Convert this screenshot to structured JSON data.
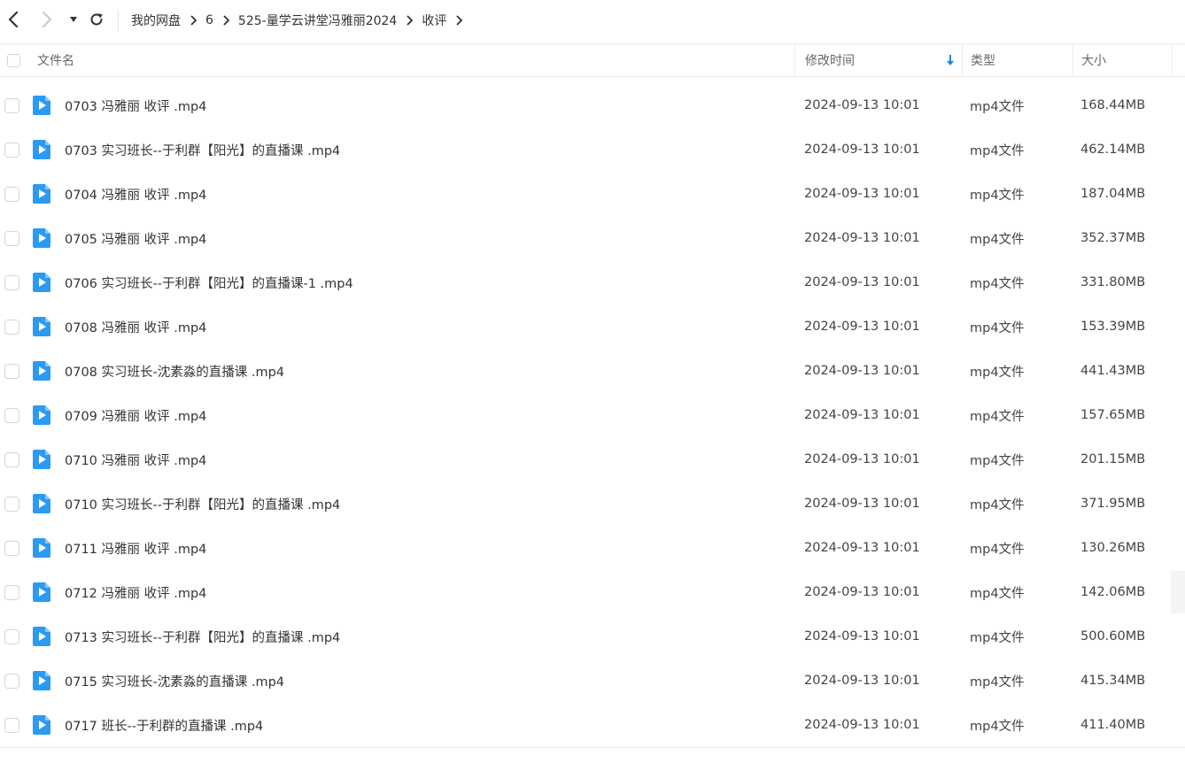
{
  "breadcrumb": [
    "我的网盘",
    "6",
    "525-量学云讲堂冯雅丽2024",
    "收评"
  ],
  "columns": {
    "name": "文件名",
    "time": "修改时间",
    "type": "类型",
    "size": "大小"
  },
  "sort_icon": "arrow-down-icon",
  "accent_color": "#1e88e5",
  "files": [
    {
      "name": "0703 冯雅丽 收评 .mp4",
      "time": "2024-09-13 10:01",
      "type": "mp4文件",
      "size": "168.44MB"
    },
    {
      "name": "0703 实习班长--于利群【阳光】的直播课 .mp4",
      "time": "2024-09-13 10:01",
      "type": "mp4文件",
      "size": "462.14MB"
    },
    {
      "name": "0704 冯雅丽 收评 .mp4",
      "time": "2024-09-13 10:01",
      "type": "mp4文件",
      "size": "187.04MB"
    },
    {
      "name": "0705 冯雅丽 收评 .mp4",
      "time": "2024-09-13 10:01",
      "type": "mp4文件",
      "size": "352.37MB"
    },
    {
      "name": "0706 实习班长--于利群【阳光】的直播课-1 .mp4",
      "time": "2024-09-13 10:01",
      "type": "mp4文件",
      "size": "331.80MB"
    },
    {
      "name": "0708 冯雅丽 收评 .mp4",
      "time": "2024-09-13 10:01",
      "type": "mp4文件",
      "size": "153.39MB"
    },
    {
      "name": "0708 实习班长-沈素淼的直播课 .mp4",
      "time": "2024-09-13 10:01",
      "type": "mp4文件",
      "size": "441.43MB"
    },
    {
      "name": "0709 冯雅丽 收评 .mp4",
      "time": "2024-09-13 10:01",
      "type": "mp4文件",
      "size": "157.65MB"
    },
    {
      "name": "0710 冯雅丽 收评 .mp4",
      "time": "2024-09-13 10:01",
      "type": "mp4文件",
      "size": "201.15MB"
    },
    {
      "name": "0710 实习班长--于利群【阳光】的直播课 .mp4",
      "time": "2024-09-13 10:01",
      "type": "mp4文件",
      "size": "371.95MB"
    },
    {
      "name": "0711 冯雅丽 收评 .mp4",
      "time": "2024-09-13 10:01",
      "type": "mp4文件",
      "size": "130.26MB"
    },
    {
      "name": "0712 冯雅丽 收评 .mp4",
      "time": "2024-09-13 10:01",
      "type": "mp4文件",
      "size": "142.06MB"
    },
    {
      "name": "0713 实习班长--于利群【阳光】的直播课 .mp4",
      "time": "2024-09-13 10:01",
      "type": "mp4文件",
      "size": "500.60MB"
    },
    {
      "name": "0715 实习班长-沈素淼的直播课 .mp4",
      "time": "2024-09-13 10:01",
      "type": "mp4文件",
      "size": "415.34MB"
    },
    {
      "name": "0717 班长--于利群的直播课 .mp4",
      "time": "2024-09-13 10:01",
      "type": "mp4文件",
      "size": "411.40MB"
    }
  ]
}
